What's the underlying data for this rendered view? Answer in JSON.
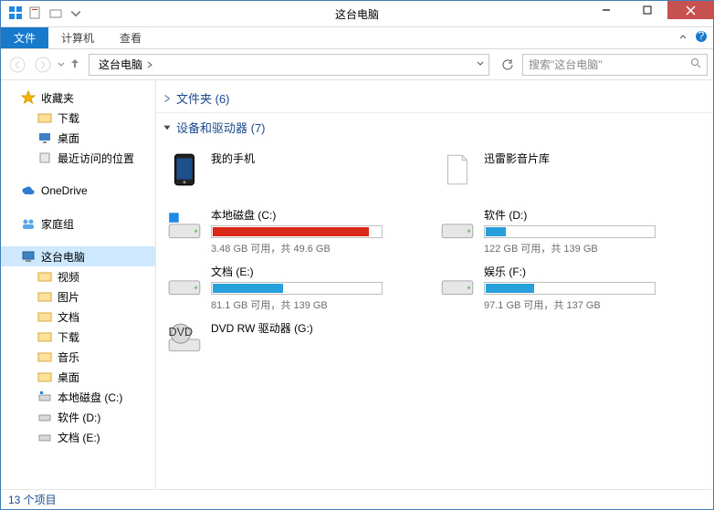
{
  "window": {
    "title": "这台电脑"
  },
  "menu": {
    "file": "文件",
    "computer": "计算机",
    "view": "查看"
  },
  "address": {
    "crumb1": "这台电脑"
  },
  "search": {
    "placeholder": "搜索\"这台电脑\""
  },
  "sidebar": {
    "favorites": {
      "label": "收藏夹",
      "items": [
        "下载",
        "桌面",
        "最近访问的位置"
      ]
    },
    "onedrive": "OneDrive",
    "homegroup": "家庭组",
    "thispc": {
      "label": "这台电脑",
      "items": [
        "视频",
        "图片",
        "文档",
        "下载",
        "音乐",
        "桌面",
        "本地磁盘 (C:)",
        "软件 (D:)",
        "文档 (E:)"
      ]
    }
  },
  "sections": {
    "folders": "文件夹 (6)",
    "devices": "设备和驱动器 (7)"
  },
  "devices": [
    {
      "name": "我的手机"
    },
    {
      "name": "迅雷影音片库"
    },
    {
      "name": "本地磁盘 (C:)",
      "status": "3.48 GB 可用，共 49.6 GB",
      "fill": 93,
      "color": "#d92817"
    },
    {
      "name": "软件 (D:)",
      "status": "122 GB 可用，共 139 GB",
      "fill": 12,
      "color": "#26a0da"
    },
    {
      "name": "文档 (E:)",
      "status": "81.1 GB 可用，共 139 GB",
      "fill": 42,
      "color": "#26a0da"
    },
    {
      "name": "娱乐 (F:)",
      "status": "97.1 GB 可用，共 137 GB",
      "fill": 29,
      "color": "#26a0da"
    },
    {
      "name": "DVD RW 驱动器 (G:)"
    }
  ],
  "status": "13 个项目"
}
